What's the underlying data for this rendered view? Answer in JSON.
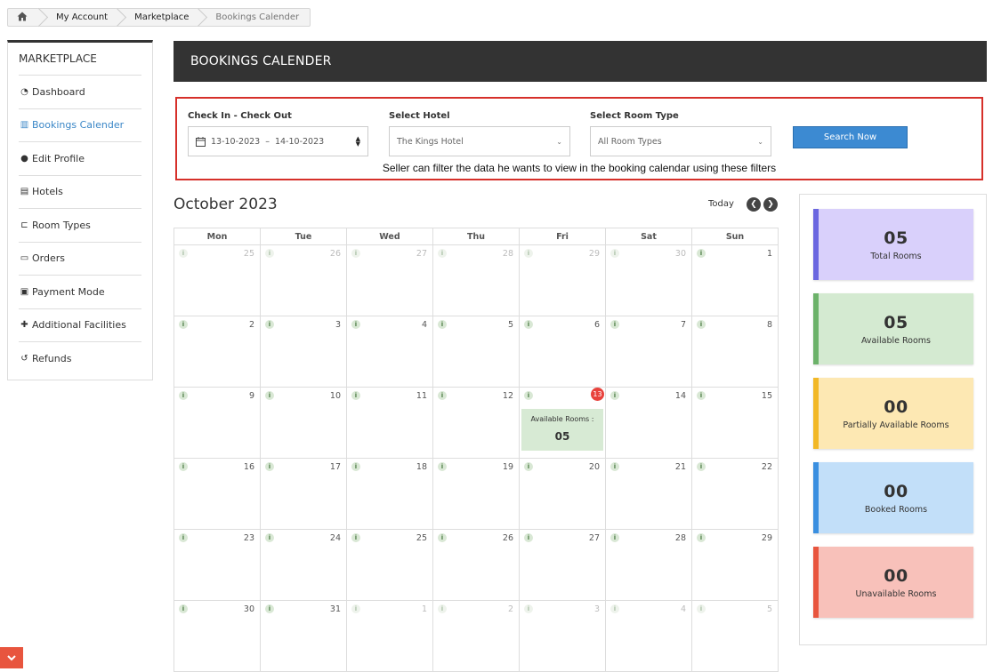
{
  "breadcrumb": {
    "home_icon": "home-icon",
    "items": [
      "My Account",
      "Marketplace",
      "Bookings Calender"
    ]
  },
  "sidebar": {
    "title": "MARKETPLACE",
    "items": [
      {
        "label": "Dashboard",
        "icon": "dashboard-icon"
      },
      {
        "label": "Bookings Calender",
        "icon": "bar-chart-icon",
        "active": true
      },
      {
        "label": "Edit Profile",
        "icon": "user-icon"
      },
      {
        "label": "Hotels",
        "icon": "building-icon"
      },
      {
        "label": "Room Types",
        "icon": "bed-icon"
      },
      {
        "label": "Orders",
        "icon": "credit-card-icon"
      },
      {
        "label": "Payment Mode",
        "icon": "money-icon"
      },
      {
        "label": "Additional Facilities",
        "icon": "user-plus-icon"
      },
      {
        "label": "Refunds",
        "icon": "undo-icon"
      }
    ]
  },
  "header": {
    "title": "BOOKINGS CALENDER"
  },
  "filters": {
    "date_label": "Check In - Check Out",
    "date_from": "13-10-2023",
    "date_sep": "–",
    "date_to": "14-10-2023",
    "hotel_label": "Select Hotel",
    "hotel_value": "The Kings Hotel",
    "room_label": "Select Room Type",
    "room_value": "All Room Types",
    "search_label": "Search Now",
    "note": "Seller can filter the data he wants to view in the booking calendar using these filters",
    "highlight_color": "#d6302a"
  },
  "calendar": {
    "month": "October 2023",
    "today_label": "Today",
    "prev_icon": "chevron-left-icon",
    "next_icon": "chevron-right-icon",
    "weekdays": [
      "Mon",
      "Tue",
      "Wed",
      "Thu",
      "Fri",
      "Sat",
      "Sun"
    ],
    "info_glyph": "i",
    "weeks": [
      [
        {
          "d": "25",
          "o": true
        },
        {
          "d": "26",
          "o": true
        },
        {
          "d": "27",
          "o": true
        },
        {
          "d": "28",
          "o": true
        },
        {
          "d": "29",
          "o": true
        },
        {
          "d": "30",
          "o": true
        },
        {
          "d": "1"
        }
      ],
      [
        {
          "d": "2"
        },
        {
          "d": "3"
        },
        {
          "d": "4"
        },
        {
          "d": "5"
        },
        {
          "d": "6"
        },
        {
          "d": "7"
        },
        {
          "d": "8"
        }
      ],
      [
        {
          "d": "9"
        },
        {
          "d": "10"
        },
        {
          "d": "11"
        },
        {
          "d": "12"
        },
        {
          "d": "13",
          "today": true
        },
        {
          "d": "14"
        },
        {
          "d": "15"
        }
      ],
      [
        {
          "d": "16"
        },
        {
          "d": "17"
        },
        {
          "d": "18"
        },
        {
          "d": "19"
        },
        {
          "d": "20"
        },
        {
          "d": "21"
        },
        {
          "d": "22"
        }
      ],
      [
        {
          "d": "23"
        },
        {
          "d": "24"
        },
        {
          "d": "25"
        },
        {
          "d": "26"
        },
        {
          "d": "27"
        },
        {
          "d": "28"
        },
        {
          "d": "29"
        }
      ],
      [
        {
          "d": "30"
        },
        {
          "d": "31"
        },
        {
          "d": "1",
          "o": true
        },
        {
          "d": "2",
          "o": true
        },
        {
          "d": "3",
          "o": true
        },
        {
          "d": "4",
          "o": true
        },
        {
          "d": "5",
          "o": true
        }
      ]
    ],
    "availability": {
      "label": "Available Rooms :",
      "value": "05"
    }
  },
  "stats": [
    {
      "value": "05",
      "label": "Total Rooms",
      "bg": "#d9d0fb",
      "border": "#6b67e0"
    },
    {
      "value": "05",
      "label": "Available Rooms",
      "bg": "#d4ead1",
      "border": "#6cb26a"
    },
    {
      "value": "00",
      "label": "Partially Available Rooms",
      "bg": "#fde8b3",
      "border": "#f2b826"
    },
    {
      "value": "00",
      "label": "Booked Rooms",
      "bg": "#c2dff9",
      "border": "#3a8fe0"
    },
    {
      "value": "00",
      "label": "Unavailable Rooms",
      "bg": "#f8c1ba",
      "border": "#e8553e"
    }
  ],
  "corner_toggle": {
    "icon": "chevron-down-icon"
  }
}
